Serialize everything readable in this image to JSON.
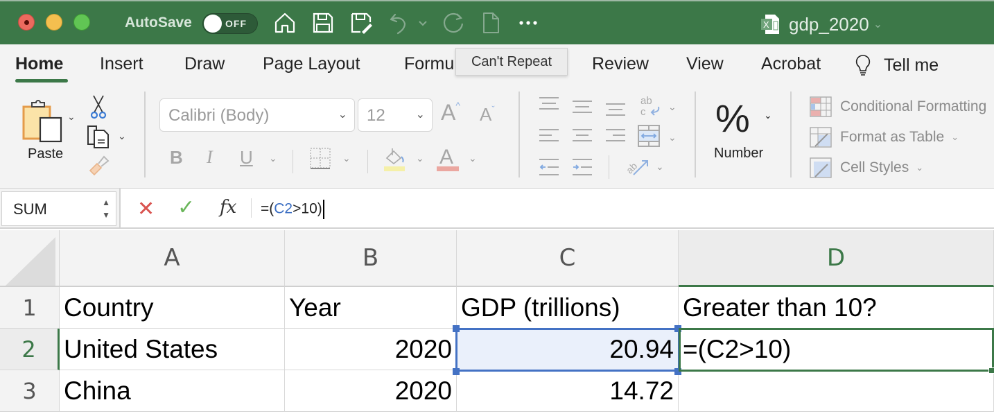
{
  "titlebar": {
    "autosave_label": "AutoSave",
    "autosave_state": "OFF",
    "quick_access": [
      "home-icon",
      "save-icon",
      "save-as-icon",
      "undo-icon",
      "redo-icon",
      "new-document-icon",
      "more-icon"
    ],
    "file_name": "gdp_2020",
    "accent_color": "#3c7848"
  },
  "ribbon": {
    "tabs": [
      {
        "label": "Home",
        "active": true
      },
      {
        "label": "Insert"
      },
      {
        "label": "Draw"
      },
      {
        "label": "Page Layout"
      },
      {
        "label": "Formu"
      },
      {
        "label": "Review"
      },
      {
        "label": "View"
      },
      {
        "label": "Acrobat"
      },
      {
        "label": "Tell me"
      }
    ],
    "tooltip": "Can't Repeat",
    "clipboard": {
      "paste_label": "Paste"
    },
    "font": {
      "name": "Calibri (Body)",
      "size": "12",
      "bold": "B",
      "italic": "I",
      "underline": "U",
      "grow": "A",
      "shrink": "A",
      "font_color": "A"
    },
    "number": {
      "symbol": "%",
      "label": "Number"
    },
    "styles": [
      {
        "label": "Conditional Formatting"
      },
      {
        "label": "Format as Table"
      },
      {
        "label": "Cell Styles"
      }
    ]
  },
  "formula_bar": {
    "name_box": "SUM",
    "cancel": "✕",
    "enter": "✓",
    "fx": "fx",
    "formula_prefix": "=(",
    "formula_ref": "C2",
    "formula_suffix": ">10)"
  },
  "sheet": {
    "columns": [
      "A",
      "B",
      "C",
      "D"
    ],
    "active_column": "D",
    "rows": [
      "1",
      "2",
      "3"
    ],
    "active_row": "2",
    "cells": {
      "A1": "Country",
      "B1": "Year",
      "C1": "GDP (trillions)",
      "D1": "Greater than 10?",
      "A2": "United States",
      "B2": "2020",
      "C2": "20.94",
      "D2": "=(C2>10)",
      "A3": "China",
      "B3": "2020",
      "C3": "14.72",
      "D3": ""
    },
    "active_cell": "D2",
    "referenced_cell": "C2"
  }
}
